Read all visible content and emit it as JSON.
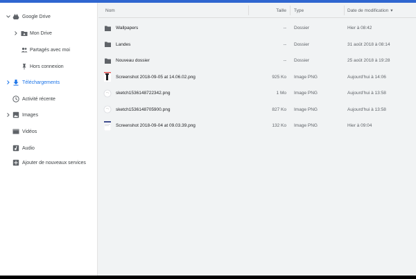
{
  "colors": {
    "accent": "#1a73e8",
    "topbar": "#2f66d0"
  },
  "sidebar": {
    "items": [
      {
        "label": "Google Drive",
        "icon": "drive-icon",
        "expanded": true
      },
      {
        "label": "Mon Drive",
        "icon": "my-drive-icon"
      },
      {
        "label": "Partagés avec moi",
        "icon": "shared-icon"
      },
      {
        "label": "Hors connexion",
        "icon": "offline-pin-icon"
      },
      {
        "label": "Téléchargements",
        "icon": "download-icon",
        "active": true
      },
      {
        "label": "Activité récente",
        "icon": "recent-icon"
      },
      {
        "label": "Images",
        "icon": "images-icon"
      },
      {
        "label": "Vidéos",
        "icon": "videos-icon"
      },
      {
        "label": "Audio",
        "icon": "audio-icon"
      },
      {
        "label": "Ajouter de nouveaux services",
        "icon": "add-icon"
      }
    ]
  },
  "table": {
    "headers": {
      "name": "Nom",
      "size": "Taille",
      "type": "Type",
      "modified": "Date de modification",
      "sort_indicator": "▾"
    },
    "rows": [
      {
        "name": "Wallpapers",
        "size": "--",
        "type": "Dossier",
        "modified": "Hier à 08:42",
        "icon": "folder-icon"
      },
      {
        "name": "Landes",
        "size": "--",
        "type": "Dossier",
        "modified": "31 août 2018 à 08:14",
        "icon": "folder-icon"
      },
      {
        "name": "Nouveau dossier",
        "size": "--",
        "type": "Dossier",
        "modified": "25 août 2018 à 19:28",
        "icon": "folder-icon"
      },
      {
        "name": "Screenshot 2018-09-05 at 14.06.02.png",
        "size": "925 Ko",
        "type": "Image PNG",
        "modified": "Aujourd'hui à 14:06",
        "icon": "image-thumbnail-icon"
      },
      {
        "name": "sketch1536148722342.png",
        "size": "1 Mo",
        "type": "Image PNG",
        "modified": "Aujourd'hui à 13:58",
        "icon": "sketch-thumbnail-icon"
      },
      {
        "name": "sketch1536148705900.png",
        "size": "827 Ko",
        "type": "Image PNG",
        "modified": "Aujourd'hui à 13:58",
        "icon": "sketch-thumbnail-icon"
      },
      {
        "name": "Screenshot 2018-09-04 at 09.03.39.png",
        "size": "132 Ko",
        "type": "Image PNG",
        "modified": "Hier à 09:04",
        "icon": "image-thumbnail-icon"
      }
    ]
  }
}
